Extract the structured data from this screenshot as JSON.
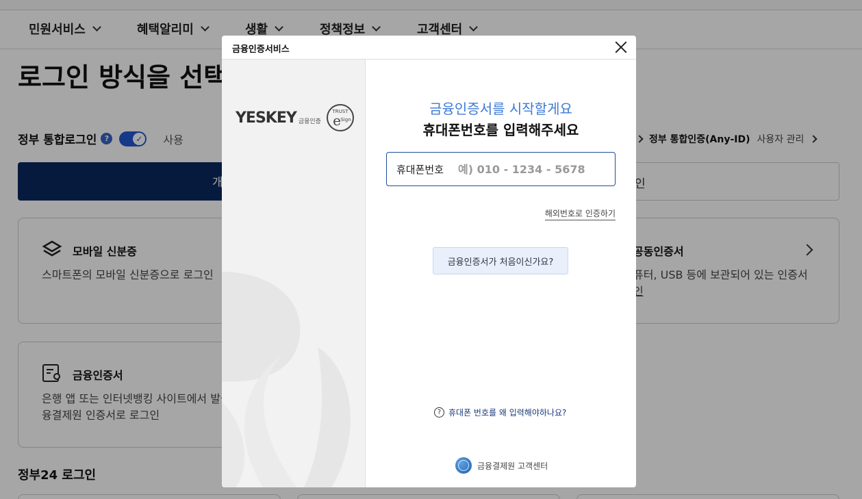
{
  "nav": {
    "items": [
      {
        "label": "민원서비스"
      },
      {
        "label": "혜택알리미"
      },
      {
        "label": "생활"
      },
      {
        "label": "정책정보"
      },
      {
        "label": "고객센터"
      }
    ]
  },
  "page": {
    "title": "로그인 방식을 선택",
    "gov_login_label": "정부 통합로그인",
    "help_mark": "?",
    "toggle_text": "사용",
    "anyid_label": "정부 통합인증(Any-ID)",
    "user_manage": "사용자 관리",
    "dark_button_partial": "개",
    "light_button_partial": "인",
    "cards": {
      "mobile_id": {
        "title": "모바일 신분증",
        "desc": "스마트폰의 모바일 신분증으로 로그인"
      },
      "joint_cert": {
        "title": "공동인증서",
        "desc_line1": "퓨터, USB 등에 보관되어 있는 인증서",
        "desc_line2": "인"
      },
      "fin_cert": {
        "title": "금융인증서",
        "desc_line1": "은행 앱 또는 인터넷뱅킹 사이트에서 발급",
        "desc_line2": "융결제원 인증서로 로그인"
      }
    },
    "section_title": "정부24 로그인"
  },
  "modal": {
    "title": "금융인증서비스",
    "brand_name": "YESKEY",
    "brand_sub": "금융인증",
    "trust_label": "TRUST",
    "sign_label": "Sign",
    "headline1": "금융인증서를 시작할게요",
    "headline2": "휴대폰번호를 입력해주세요",
    "phone_label": "휴대폰번호",
    "phone_placeholder": "예) 010 - 1234 - 5678",
    "overseas_link": "해외번호로 인증하기",
    "first_time_button": "금융인증서가 처음이신가요?",
    "why_link": "휴대폰 번호를 왜 입력해야하나요?",
    "help_center": "금융결제원 고객센터"
  },
  "colors": {
    "accent_blue": "#3d7ad6",
    "dark_navy": "#0a2860",
    "toggle_blue": "#2458d4"
  }
}
